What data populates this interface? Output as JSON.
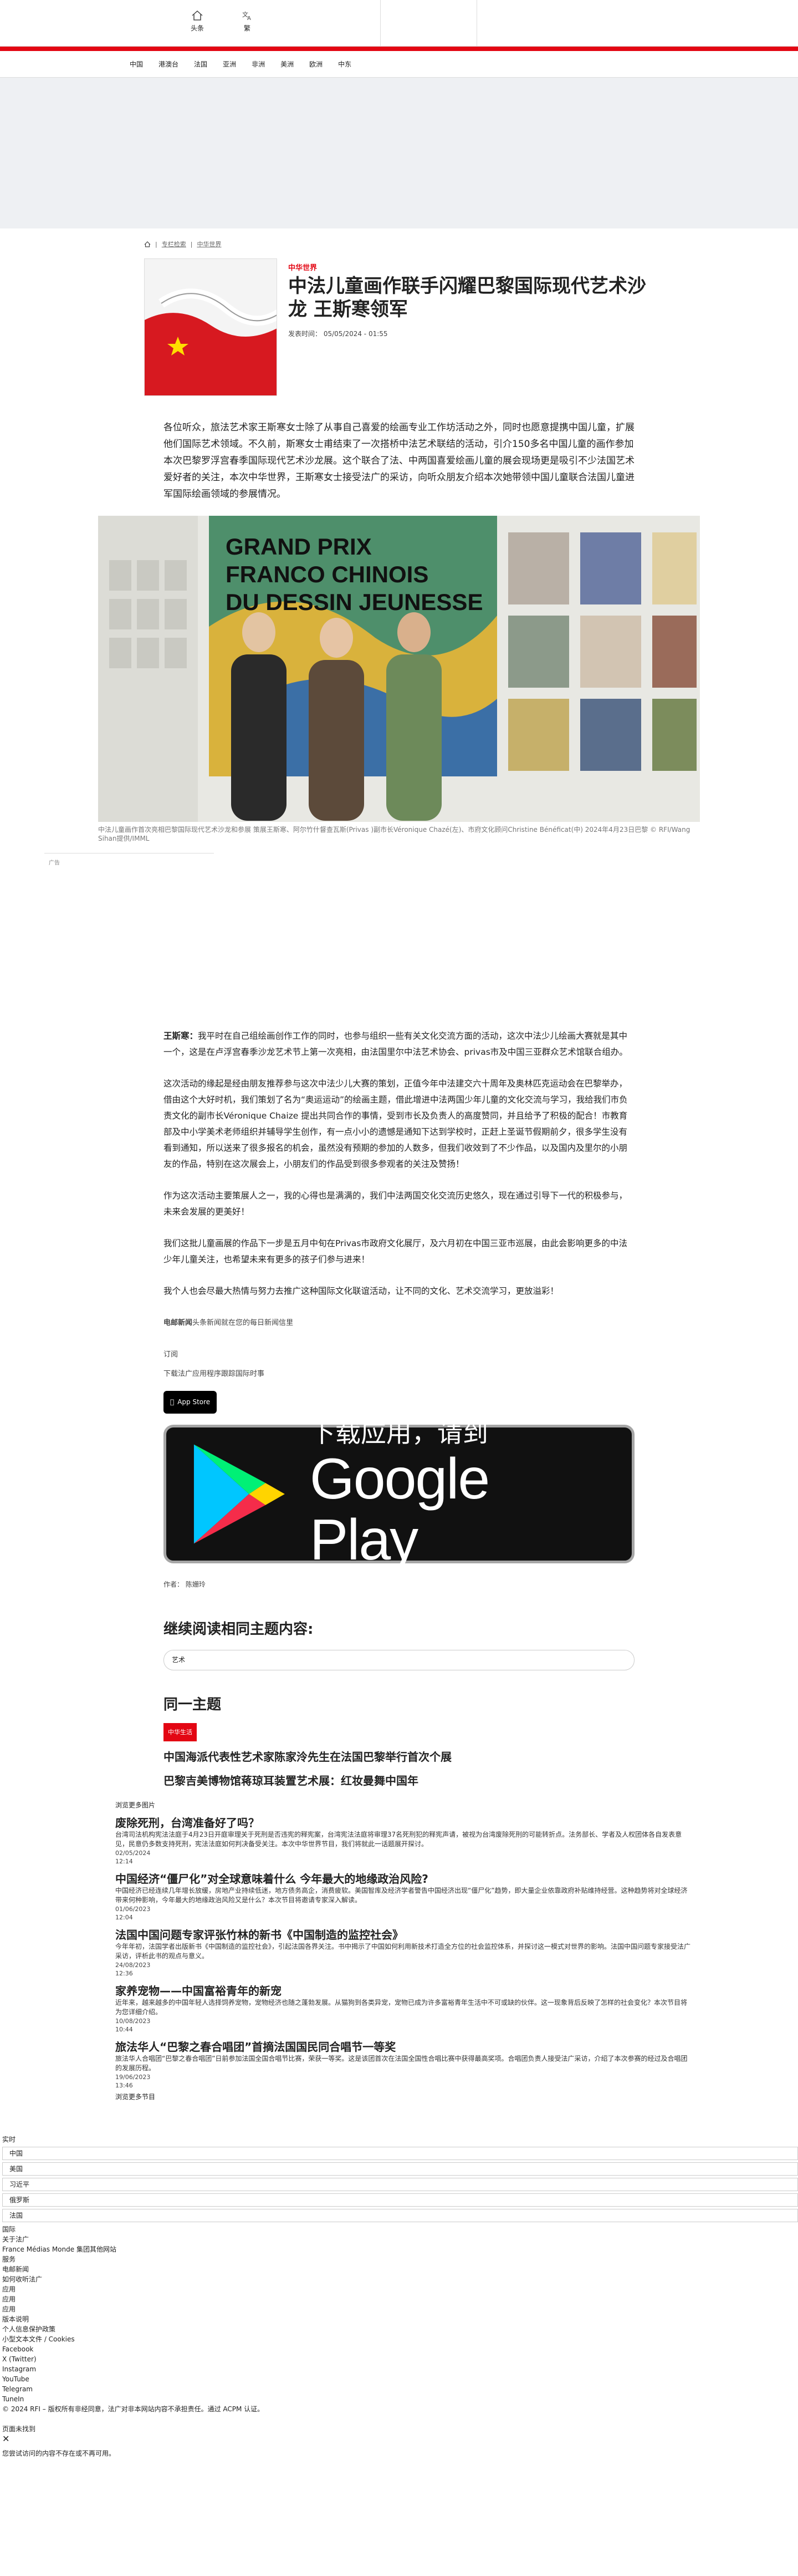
{
  "topbar": {
    "home_label": "头条",
    "translate_label": "繁"
  },
  "nav": [
    "中国",
    "港澳台",
    "法国",
    "亚洲",
    "非洲",
    "美洲",
    "欧洲",
    "中东"
  ],
  "breadcrumb": [
    "专栏检索",
    "中华世界"
  ],
  "article": {
    "kicker": "中华世界",
    "title": "中法儿童画作联手闪耀巴黎国际现代艺术沙龙 王斯寒领军",
    "meta": "发表时间： 05/05/2024 - 01:55",
    "lead": "各位听众，旅法艺术家王斯寒女士除了从事自己喜爱的绘画专业工作坊活动之外，同时也愿意提携中国儿童，扩展他们国际艺术领域。不久前，斯寒女士甫结束了一次搭桥中法艺术联结的活动，引介150多名中国儿童的画作参加本次巴黎罗浮宫春季国际现代艺术沙龙展。这个联合了法、中两国喜爱绘画儿童的展会现场更是吸引不少法国艺术爱好者的关注，本次中华世界，王斯寒女士接受法广的采访，向听众朋友介绍本次她带领中国儿童联合法国儿童进军国际绘画领域的参展情况。",
    "photo_text": [
      "GRAND PRIX",
      "FRANCO CHINOIS",
      "DU DESSIN JEUNESSE"
    ],
    "caption": "中法儿童画作首次亮相巴黎国际现代艺术沙龙和参展 策展王斯寒、阿尔竹什督查瓦斯(Privas )副市长Véronique Chazé(左)、市府文化顾问Christine Bénéficat(中) 2024年4月23日巴黎 © RFI/Wang Sihan提供/IMML",
    "ad_label": "广告",
    "paragraphs": [
      {
        "lead": "王斯寒：",
        "text": "我平时在自己组绘画创作工作的同时，也参与组织一些有关文化交流方面的活动，这次中法少儿绘画大赛就是其中一个，这是在卢浮宫春季沙龙艺术节上第一次亮相，由法国里尔中法艺术协会、privas市及中国三亚群众艺术馆联合组办。"
      },
      {
        "lead": "",
        "text": "这次活动的缘起是经由朋友推荐参与这次中法少儿大赛的策划，正值今年中法建交六十周年及奥林匹克运动会在巴黎举办，借由这个大好时机，我们策划了名为“奥运运动”的绘画主题，借此增进中法两国少年儿童的文化交流与学习，我给我们市负责文化的副市长Véronique Chaize 提出共同合作的事情，受到市长及负责人的高度赞同，并且给予了积极的配合！市教育部及中小学美术老师组织并辅导学生创作，有一点小小的遗憾是通知下达到学校时，正赶上圣诞节假期前夕，很多学生没有看到通知，所以送来了很多报名的机会，虽然没有预期的参加的人数多，但我们收效到了不少作品，以及国内及里尔的小朋友的作品，特别在这次展会上，小朋友们的作品受到很多参观者的关注及赞扬！"
      },
      {
        "lead": "",
        "text": "作为这次活动主要策展人之一，我的心得也是满满的，我们中法两国交化交流历史悠久，现在通过引导下一代的积极参与，未来会发展的更美好！"
      },
      {
        "lead": "",
        "text": "我们这批儿童画展的作品下一步是五月中旬在Privas市政府文化展厅，及六月初在中国三亚市巡展，由此会影响更多的中法少年儿童关注，也希望未来有更多的孩子们参与进来！"
      },
      {
        "lead": "",
        "text": "我个人也会尽最大热情与努力去推广这种国际文化联谊活动，让不同的文化、艺术交流学习，更放溢彩！"
      }
    ],
    "newsletter_lead": "电邮新闻",
    "newsletter_text": "头条新闻就在您的每日新闻信里",
    "subscribe": "订阅",
    "download_app": "下载法广应用程序跟踪国际时事",
    "appstore_label": "App Store",
    "gplay_line1": "下载应用，请到",
    "gplay_line2": "Google Play",
    "author": "作者： 陈姗玲"
  },
  "related": {
    "title": "继续阅读相同主题内容:",
    "tag": "艺术"
  },
  "same_theme": {
    "title": "同一主题",
    "badge": "中华生活",
    "items": [
      "中国海派代表性艺术家陈家泠先生在法国巴黎举行首次个展",
      "巴黎吉美博物馆蒋琼耳装置艺术展：红妆曼舞中国年"
    ]
  },
  "more": {
    "label": "浏览更多图片",
    "items": [
      {
        "title": "废除死刑，台湾准备好了吗？",
        "desc": "台湾司法机构宪法法庭于4月23日开庭审理关于死刑是否违宪的释宪案，台湾宪法法庭将审理37名死刑犯的释宪声请，被视为台湾废除死刑的可能转折点。法务部长、学者及人权团体各自发表意见，民意仍多数支持死刑，宪法法庭如何判决备受关注。本次中华世界节目，我们将就此一话题展开探讨。",
        "date1": "02/05/2024",
        "date2": "12:14"
      },
      {
        "title": "中国经济“僵尸化”对全球意味着什么 今年最大的地缘政治风险?",
        "desc": "中国经济已经连续几年增长放缓，房地产业持续低迷，地方债务高企，消费疲软。美国智库及经济学者警告中国经济出现“僵尸化”趋势，即大量企业依靠政府补贴维持经营。这种趋势将对全球经济带来何种影响，今年最大的地缘政治风险又是什么？本次节目将邀请专家深入解读。",
        "date1": "01/06/2023",
        "date2": "12:04"
      },
      {
        "title": "法国中国问题专家评张竹林的新书《中国制造的监控社会》",
        "desc": "今年年初，法国学者出版新书《中国制造的监控社会》，引起法国各界关注。书中揭示了中国如何利用新技术打造全方位的社会监控体系，并探讨这一模式对世界的影响。法国中国问题专家接受法广采访，评析此书的观点与意义。",
        "date1": "24/08/2023",
        "date2": "12:36"
      },
      {
        "title": "家养宠物——中国富裕青年的新宠",
        "desc": "近年来，越来越多的中国年轻人选择饲养宠物，宠物经济也随之蓬勃发展。从猫狗到各类异宠，宠物已成为许多富裕青年生活中不可或缺的伙伴。这一现象背后反映了怎样的社会变化？本次节目将为您详细介绍。",
        "date1": "10/08/2023",
        "date2": "10:44"
      },
      {
        "title": "旅法华人“巴黎之春合唱团”首摘法国国民同合唱节一等奖",
        "desc": "旅法华人合唱团“巴黎之春合唱团”日前参加法国全国合唱节比赛，荣获一等奖。这是该团首次在法国全国性合唱比赛中获得最高奖项。合唱团负责人接受法广采访，介绍了本次参赛的经过及合唱团的发展历程。",
        "date1": "19/06/2023",
        "date2": "13:46"
      }
    ],
    "browse_more": "浏览更多节目"
  },
  "footer": {
    "live_label": "实时",
    "languages": [
      "中国",
      "美国",
      "习近平",
      "俄罗斯",
      "法国"
    ],
    "links": [
      "国际",
      "关于法广",
      "France Médias Monde 集团其他网站",
      "服务",
      "电邮新闻",
      "如何收听法广",
      "应用",
      "应用",
      "应用",
      "版本说明",
      "个人信息保护政策",
      "小型文本文件 / Cookies",
      "Facebook",
      "X (Twitter)",
      "Instagram",
      "YouTube",
      "Telegram",
      "TuneIn"
    ],
    "copyright": "© 2024 RFI – 版权所有非经同意，法广对非本网站内容不承担责任。通过 ACPM 认证。",
    "page_not_found": "页面未找到",
    "not_found_msg": "您尝试访问的内容不存在或不再可用。"
  },
  "colors": {
    "accent": "#e30613"
  }
}
